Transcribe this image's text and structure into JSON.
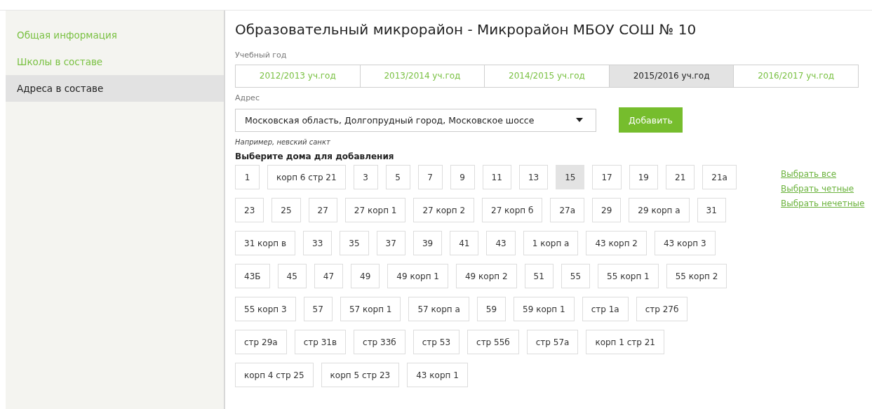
{
  "sidebar": {
    "items": [
      {
        "label": "Общая информация",
        "selected": false
      },
      {
        "label": "Школы в составе",
        "selected": false
      },
      {
        "label": "Адреса в составе",
        "selected": true
      }
    ]
  },
  "title": "Образовательный микрорайон - Микрорайон МБОУ СОШ № 10",
  "year_label": "Учебный год",
  "year_tabs": [
    {
      "label": "2012/2013 уч.год",
      "selected": false
    },
    {
      "label": "2013/2014 уч.год",
      "selected": false
    },
    {
      "label": "2014/2015 уч.год",
      "selected": false
    },
    {
      "label": "2015/2016 уч.год",
      "selected": true
    },
    {
      "label": "2016/2017 уч.год",
      "selected": false
    }
  ],
  "address_label": "Адрес",
  "address_value": "Московская область, Долгопрудный город, Московское шоссе",
  "add_button": "Добавить",
  "hint": "Например, невский санкт",
  "houses_heading": "Выберите дома для добавления",
  "house_rows": [
    [
      {
        "label": "1",
        "selected": false
      },
      {
        "label": "корп 6 стр 21",
        "selected": false
      },
      {
        "label": "3",
        "selected": false
      },
      {
        "label": "5",
        "selected": false
      },
      {
        "label": "7",
        "selected": false
      },
      {
        "label": "9",
        "selected": false
      },
      {
        "label": "11",
        "selected": false
      },
      {
        "label": "13",
        "selected": false
      },
      {
        "label": "15",
        "selected": true
      },
      {
        "label": "17",
        "selected": false
      },
      {
        "label": "19",
        "selected": false
      },
      {
        "label": "21",
        "selected": false
      },
      {
        "label": "21а",
        "selected": false
      }
    ],
    [
      {
        "label": "23",
        "selected": false
      },
      {
        "label": "25",
        "selected": false
      },
      {
        "label": "27",
        "selected": false
      },
      {
        "label": "27 корп 1",
        "selected": false
      },
      {
        "label": "27 корп 2",
        "selected": false
      },
      {
        "label": "27 корп б",
        "selected": false
      },
      {
        "label": "27а",
        "selected": false
      },
      {
        "label": "29",
        "selected": false
      },
      {
        "label": "29 корп а",
        "selected": false
      },
      {
        "label": "31",
        "selected": false
      }
    ],
    [
      {
        "label": "31 корп в",
        "selected": false
      },
      {
        "label": "33",
        "selected": false
      },
      {
        "label": "35",
        "selected": false
      },
      {
        "label": "37",
        "selected": false
      },
      {
        "label": "39",
        "selected": false
      },
      {
        "label": "41",
        "selected": false
      },
      {
        "label": "43",
        "selected": false
      },
      {
        "label": "1 корп а",
        "selected": false
      },
      {
        "label": "43 корп 2",
        "selected": false
      },
      {
        "label": "43 корп 3",
        "selected": false
      }
    ],
    [
      {
        "label": "43Б",
        "selected": false
      },
      {
        "label": "45",
        "selected": false
      },
      {
        "label": "47",
        "selected": false
      },
      {
        "label": "49",
        "selected": false
      },
      {
        "label": "49 корп 1",
        "selected": false
      },
      {
        "label": "49 корп 2",
        "selected": false
      },
      {
        "label": "51",
        "selected": false
      },
      {
        "label": "55",
        "selected": false
      },
      {
        "label": "55 корп 1",
        "selected": false
      },
      {
        "label": "55 корп 2",
        "selected": false
      }
    ],
    [
      {
        "label": "55 корп 3",
        "selected": false
      },
      {
        "label": "57",
        "selected": false
      },
      {
        "label": "57 корп 1",
        "selected": false
      },
      {
        "label": "57 корп а",
        "selected": false
      },
      {
        "label": "59",
        "selected": false
      },
      {
        "label": "59 корп 1",
        "selected": false
      },
      {
        "label": "стр 1а",
        "selected": false
      },
      {
        "label": "стр 27б",
        "selected": false
      }
    ],
    [
      {
        "label": "стр 29а",
        "selected": false
      },
      {
        "label": "стр 31в",
        "selected": false
      },
      {
        "label": "стр 33б",
        "selected": false
      },
      {
        "label": "стр 53",
        "selected": false
      },
      {
        "label": "стр 55б",
        "selected": false
      },
      {
        "label": "стр 57а",
        "selected": false
      },
      {
        "label": "корп 1 стр 21",
        "selected": false
      }
    ],
    [
      {
        "label": "корп 4 стр 25",
        "selected": false
      },
      {
        "label": "корп 5 стр 23",
        "selected": false
      },
      {
        "label": "43 корп 1",
        "selected": false
      }
    ]
  ],
  "select_links": [
    "Выбрать все",
    "Выбрать четные",
    "Выбрать нечетные"
  ]
}
